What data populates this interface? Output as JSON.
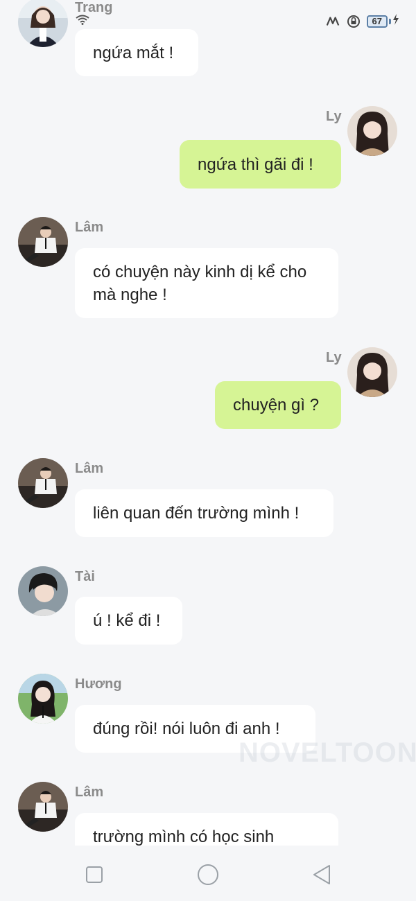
{
  "status_bar": {
    "battery_level": "67",
    "icons": [
      "link-icon",
      "lock-rotation-icon",
      "battery-icon",
      "charging-icon",
      "wifi-icon"
    ]
  },
  "messages": [
    {
      "sender": "Trang",
      "text": "ngứa mắt !",
      "direction": "incoming"
    },
    {
      "sender": "Ly",
      "text": "ngứa thì gãi đi !",
      "direction": "outgoing"
    },
    {
      "sender": "Lâm",
      "text": "có chuyện này kinh dị kể cho mà nghe !",
      "direction": "incoming"
    },
    {
      "sender": "Ly",
      "text": "chuyện gì ?",
      "direction": "outgoing"
    },
    {
      "sender": "Lâm",
      "text": "liên quan đến trường mình !",
      "direction": "incoming"
    },
    {
      "sender": "Tài",
      "text": "ú ! kể đi !",
      "direction": "incoming"
    },
    {
      "sender": "Hương",
      "text": "đúng rồi! nói luôn đi anh !",
      "direction": "incoming"
    },
    {
      "sender": "Lâm",
      "text": "trường mình có học sinh",
      "direction": "incoming"
    }
  ],
  "watermark": "NOVELTOON",
  "colors": {
    "background": "#f5f6f8",
    "incoming_bubble": "#ffffff",
    "outgoing_bubble": "#d6f495",
    "sender_text": "#8a8a8a"
  },
  "navbar": {
    "buttons": [
      "recent-apps-icon",
      "home-icon",
      "back-icon"
    ]
  }
}
